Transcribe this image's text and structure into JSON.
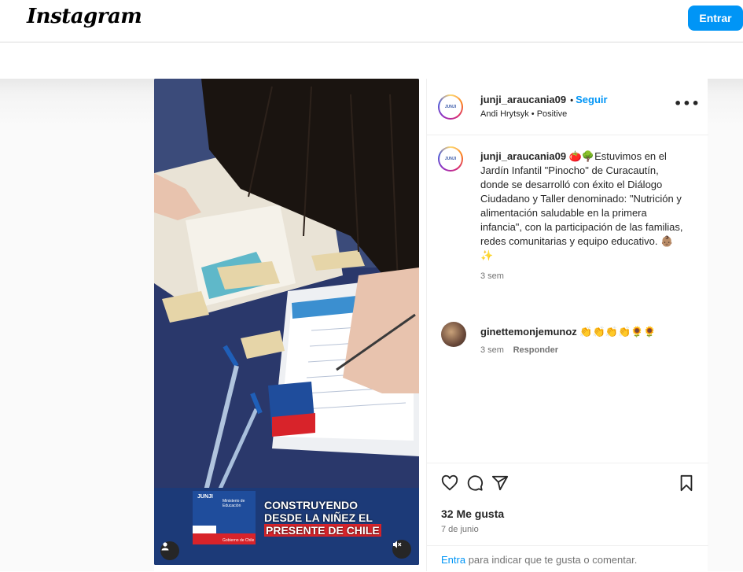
{
  "header": {
    "logo_text": "Instagram",
    "login_button": "Entrar"
  },
  "post": {
    "author": "junji_araucania09",
    "follow_label": "Seguir",
    "audio_line": "Andi Hrytsyk • Positive",
    "avatar_text": "JUNJI",
    "more_icon": "more-horizontal-icon",
    "media": {
      "banner_lines": [
        "CONSTRUYENDO",
        "DESDE LA NIÑEZ EL",
        "PRESENTE DE CHILE"
      ],
      "logo_brand": "JUNJI",
      "logo_ministry": "Ministerio de Educación",
      "logo_gov": "Gobierno de Chile",
      "tag_icon": "user-icon",
      "mute_icon": "mute-icon"
    },
    "caption": {
      "username": "junji_araucania09",
      "text": "🍅🌳Estuvimos en el Jardín Infantil \"Pinocho\" de Curacautín, donde se desarrolló con éxito el Diálogo Ciudadano y Taller denominado: \"Nutrición y alimentación saludable en la primera infancia\", con la participación de las familias, redes comunitarias y equipo educativo. 👶🏽✨",
      "time": "3 sem"
    },
    "comments": [
      {
        "username": "ginettemonjemunoz",
        "text": "👏👏👏👏🌻🌻",
        "time": "3 sem",
        "reply_label": "Responder"
      }
    ],
    "actions": {
      "like_icon": "heart-icon",
      "comment_icon": "comment-icon",
      "share_icon": "send-icon",
      "save_icon": "bookmark-icon"
    },
    "likes": "32 Me gusta",
    "date": "7 de junio",
    "login_prompt_link": "Entra",
    "login_prompt_text": " para indicar que te gusta o comentar."
  }
}
